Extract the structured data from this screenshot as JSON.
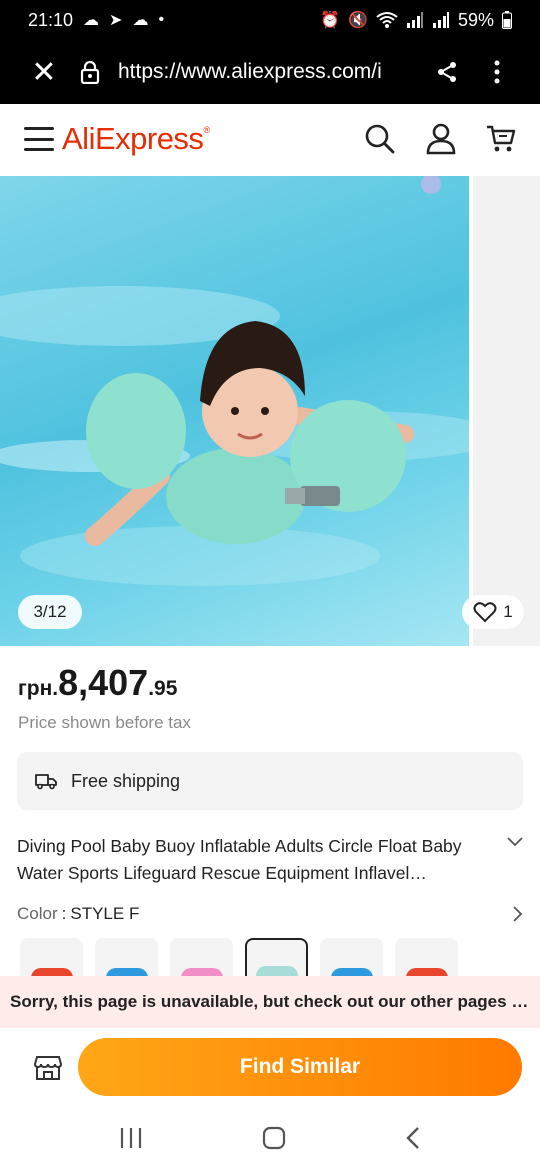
{
  "status_bar": {
    "time": "21:10",
    "battery": "59%"
  },
  "browser": {
    "url": "https://www.aliexpress.com/i"
  },
  "header": {
    "logo": "AliExpress",
    "logo_mark": "®",
    "brand_color": "#e62e04"
  },
  "gallery": {
    "counter": "3/12",
    "wishlist_count": "1"
  },
  "product": {
    "currency": "грн.",
    "price_integer": "8,407",
    "price_decimal": ".95",
    "tax_note": "Price shown before tax",
    "shipping": "Free shipping",
    "title": "Diving Pool Baby Buoy Inflatable Adults Circle Float Baby Water Sports Lifeguard Rescue Equipment Inflavel…",
    "color_label": "Color",
    "color_value": "STYLE F",
    "swatch_colors": [
      "#e8452c",
      "#2e9be0",
      "#f08ec8",
      "#a8dcd8",
      "#2e9be0",
      "#e8452c"
    ],
    "selected_swatch": 3
  },
  "error": {
    "message": "Sorry, this page is unavailable, but check out our other pages t..."
  },
  "actions": {
    "find_similar": "Find Similar",
    "accent": "#ff8a00"
  }
}
